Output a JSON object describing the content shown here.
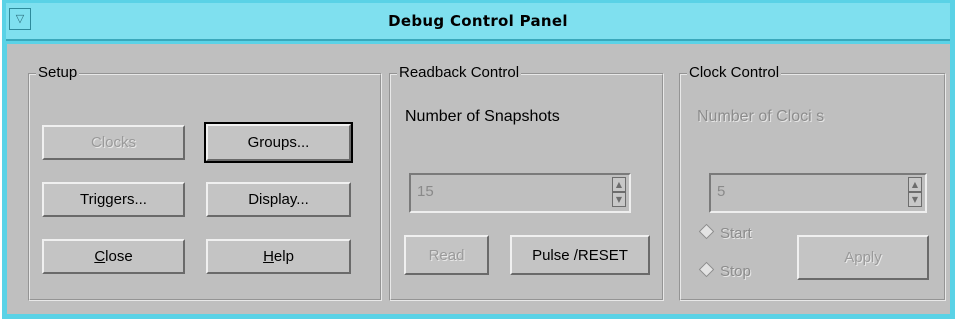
{
  "window": {
    "title": "Debug Control Panel",
    "menu_glyph": "▽",
    "accent_color": "#5ad2e6"
  },
  "setup": {
    "label": "Setup",
    "buttons": [
      {
        "label": "Clocks",
        "enabled": false
      },
      {
        "label": "Groups...",
        "enabled": true,
        "focused": true
      },
      {
        "label": "Triggers...",
        "enabled": true
      },
      {
        "label": "Display...",
        "enabled": true
      },
      {
        "label": "Close",
        "mnemonic": "C",
        "rest": "lose",
        "enabled": true
      },
      {
        "label": "Help",
        "mnemonic": "H",
        "rest": "elp",
        "enabled": true
      }
    ]
  },
  "readback": {
    "label": "Readback Control",
    "snapshots_label": "Number of Snapshots",
    "snapshots_value": "15",
    "read_label": "Read",
    "pulse_label": "Pulse /RESET"
  },
  "clock": {
    "label": "Clock Control",
    "clocks_label": "Number of Cloci s",
    "clocks_value": "5",
    "start_label": "Start",
    "stop_label": "Stop",
    "apply_label": "Apply"
  }
}
